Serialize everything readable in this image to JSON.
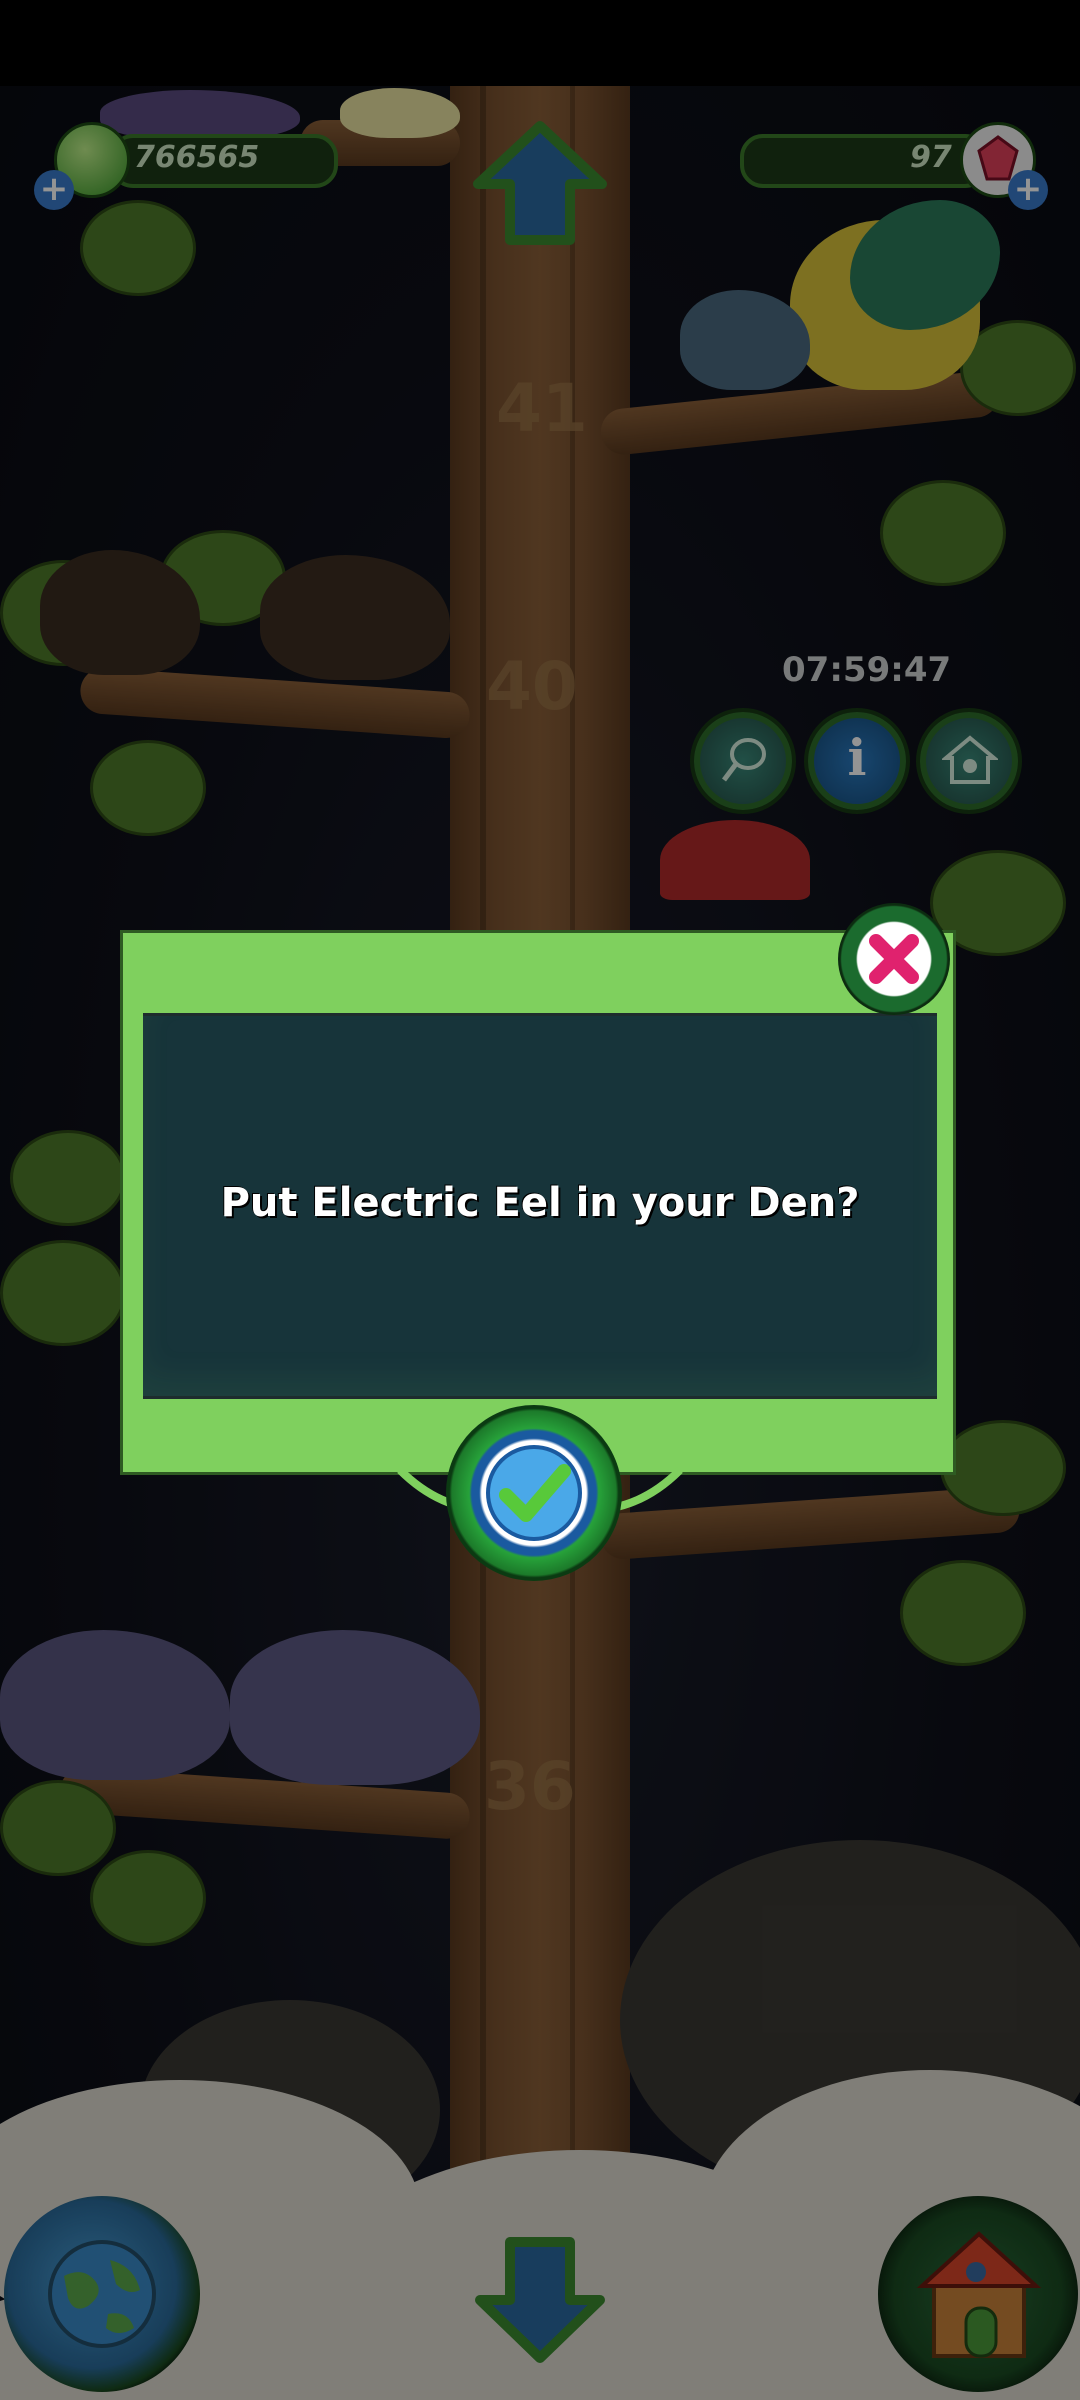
{
  "hud": {
    "currency_amount": "766565",
    "gems_amount": "97",
    "timer": "07:59:47"
  },
  "tree_levels": [
    "41",
    "40",
    "36"
  ],
  "dialog": {
    "message": "Put Electric Eel in your Den?"
  },
  "icons": {
    "up": "arrow-up-icon",
    "down": "arrow-down-icon",
    "close": "close-icon",
    "confirm": "checkmark-icon",
    "net": "net-icon",
    "info": "info-icon",
    "den": "den-icon",
    "globe": "globe-icon",
    "house": "house-icon",
    "gem": "gem-icon",
    "add": "plus-icon"
  },
  "colors": {
    "dialog_green": "#7fd05e",
    "dialog_panel": "#17343a",
    "close_x": "#e0226e",
    "confirm_check": "#58c93a"
  }
}
